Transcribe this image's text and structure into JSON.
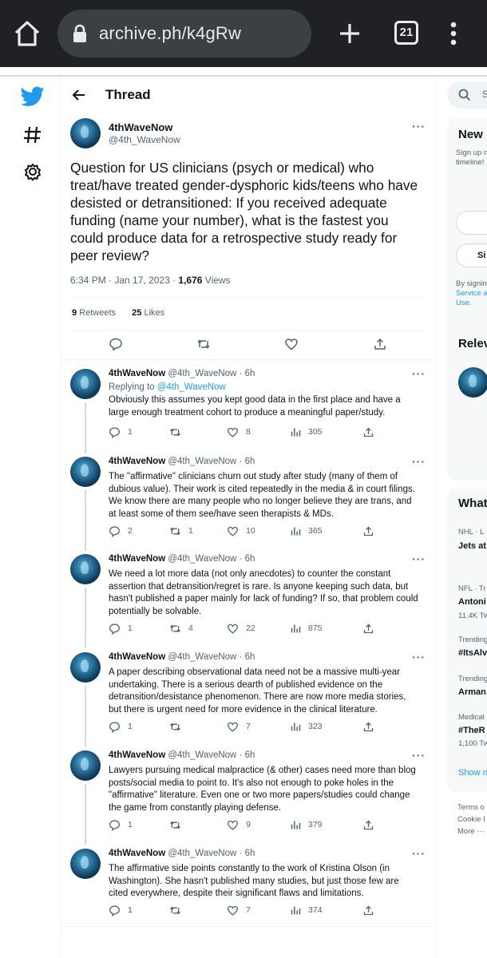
{
  "browser": {
    "url": "archive.ph/k4gRw",
    "tab_count": "21"
  },
  "header": {
    "title": "Thread"
  },
  "main_tweet": {
    "name": "4thWaveNow",
    "handle": "@4th_WaveNow",
    "more": "···",
    "text": "Question for US clinicians (psych or medical) who treat/have treated gender-dysphoric kids/teens who have desisted or detransitioned: If you received adequate funding (name your number), what is the fastest you could produce data for a retrospective study ready for peer review?",
    "time": "6:34 PM · Jan 17, 2023 · ",
    "views_count": "1,676",
    "views_label": " Views",
    "retweets_count": "9",
    "retweets_label": " Retweets",
    "likes_count": "25",
    "likes_label": " Likes"
  },
  "replies": [
    {
      "name": "4thWaveNow",
      "handle": " @4th_WaveNow · 6h",
      "replying_prefix": "Replying to ",
      "replying_to": "@4th_WaveNow",
      "text": "Obviously this assumes you kept good data in the first place and have a large enough treatment cohort to  produce a meaningful paper/study.",
      "replies": "1",
      "retweets": "",
      "likes": "8",
      "views": "305"
    },
    {
      "name": "4thWaveNow",
      "handle": " @4th_WaveNow · 6h",
      "text": "The \"affirmative\" clinicians churn out study after study (many of them of dubious value). Their work is cited repeatedly in the media & in court filings. We know there are many people who no longer believe they are trans, and at least some of them see/have seen  therapists & MDs.",
      "replies": "2",
      "retweets": "1",
      "likes": "10",
      "views": "365"
    },
    {
      "name": "4thWaveNow",
      "handle": " @4th_WaveNow · 6h",
      "text": "We need a lot more data (not only anecdotes) to counter the constant assertion that detransition/regret is rare. Is anyone keeping such data, but hasn't published a paper mainly for lack of funding? If so, that problem could potentially be solvable.",
      "replies": "1",
      "retweets": "4",
      "likes": "22",
      "views": "875"
    },
    {
      "name": "4thWaveNow",
      "handle": " @4th_WaveNow · 6h",
      "text": "A paper describing observational data need not be a massive multi-year undertaking. There is a serious dearth of published evidence on the detransition/desistance phenomenon. There are now  more media stories, but there is urgent need for more evidence in the clinical literature.",
      "replies": "1",
      "retweets": "",
      "likes": "7",
      "views": "323"
    },
    {
      "name": "4thWaveNow",
      "handle": " @4th_WaveNow · 6h",
      "text": "Lawyers pursuing medical malpractice (& other) cases need more than blog posts/social media to point to. It's also not enough to poke holes in the \"affirmative\" literature. Even one or two more papers/studies could change the game from constantly playing defense.",
      "replies": "1",
      "retweets": "",
      "likes": "9",
      "views": "379"
    },
    {
      "name": "4thWaveNow",
      "handle": " @4th_WaveNow · 6h",
      "text": "The affirmative side points constantly to the work of Kristina Olson (in Washington). She hasn't published  many studies, but just those few are cited everywhere, despite their significant flaws and limitations.",
      "replies": "1",
      "retweets": "",
      "likes": "7",
      "views": "374"
    }
  ],
  "right": {
    "search_placeholder": "S",
    "new_heading": "New",
    "new_sub1": "Sign up n",
    "new_sub2": "timeline!",
    "signup_btn2": "Si",
    "legal1": "By signin",
    "legal2": "Service a",
    "legal3": "Use.",
    "relevant_heading": "Relev",
    "whats_heading": "What",
    "trends": [
      {
        "meta": "NHL · L",
        "title": "Jets at",
        "count": ""
      },
      {
        "meta": "NFL · Tr",
        "title": "Antoni",
        "count": "11.4K Tw"
      },
      {
        "meta": "Trending",
        "title": "#ItsAlv",
        "count": ""
      },
      {
        "meta": "Trending",
        "title": "Arman",
        "count": ""
      },
      {
        "meta": "Medical",
        "title": "#TheR",
        "count": "1,100 Tw"
      }
    ],
    "show_more": "Show m",
    "footer1": "Terms o",
    "footer2": "Cookie I",
    "footer3": "More ···"
  }
}
